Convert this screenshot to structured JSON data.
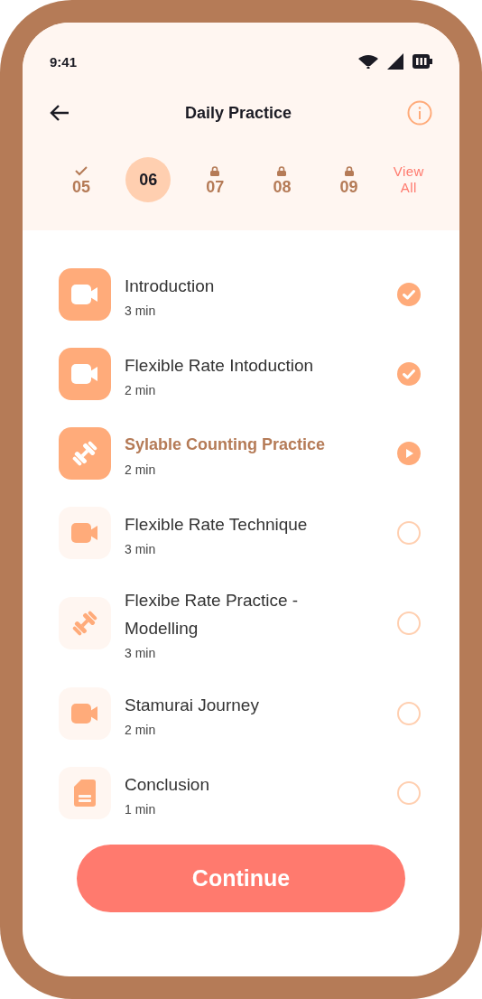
{
  "status_bar": {
    "time": "9:41"
  },
  "header": {
    "title": "Daily Practice"
  },
  "days": [
    {
      "label": "05",
      "completed": true,
      "locked": false,
      "selected": false
    },
    {
      "label": "06",
      "completed": false,
      "locked": false,
      "selected": true
    },
    {
      "label": "07",
      "completed": false,
      "locked": true,
      "selected": false
    },
    {
      "label": "08",
      "completed": false,
      "locked": true,
      "selected": false
    },
    {
      "label": "09",
      "completed": false,
      "locked": true,
      "selected": false
    }
  ],
  "view_all": "View\nAll",
  "lessons": [
    {
      "title": "Introduction",
      "duration": "3 min",
      "kind": "video",
      "completed": true,
      "current": false
    },
    {
      "title": "Flexible Rate Intoduction",
      "duration": "2 min",
      "kind": "video",
      "completed": true,
      "current": false
    },
    {
      "title": "Sylable Counting Practice",
      "duration": "2 min",
      "kind": "exercise",
      "completed": false,
      "current": true
    },
    {
      "title": "Flexible Rate Technique",
      "duration": "3 min",
      "kind": "video",
      "completed": false,
      "current": false
    },
    {
      "title": "Flexibe Rate Practice - Modelling",
      "duration": "3 min",
      "kind": "exercise",
      "completed": false,
      "current": false
    },
    {
      "title": "Stamurai Journey",
      "duration": "2 min",
      "kind": "video",
      "completed": false,
      "current": false
    },
    {
      "title": "Conclusion",
      "duration": "1 min",
      "kind": "document",
      "completed": false,
      "current": false
    }
  ],
  "continue_button": "Continue"
}
